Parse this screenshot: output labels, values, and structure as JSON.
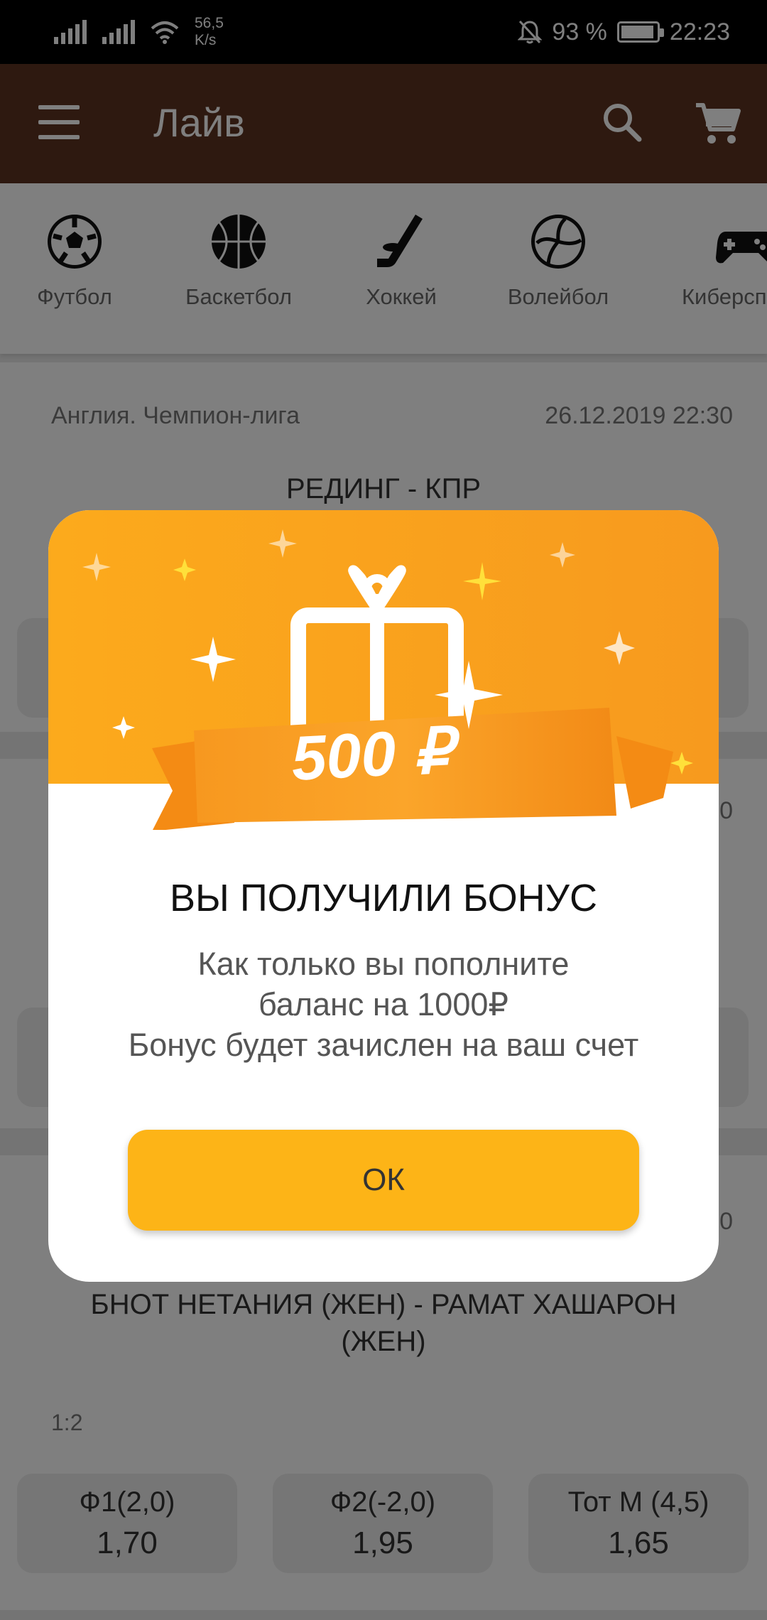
{
  "status_bar": {
    "net_speed_value": "56,5",
    "net_speed_unit": "K/s",
    "battery_percent": "93 %",
    "battery_level": 0.93,
    "time": "22:23"
  },
  "app_bar": {
    "title": "Лайв",
    "color": "#5c3220"
  },
  "sports": [
    {
      "label": "Футбол",
      "icon": "soccer-ball-icon"
    },
    {
      "label": "Баскетбол",
      "icon": "basketball-icon"
    },
    {
      "label": "Хоккей",
      "icon": "hockey-stick-icon"
    },
    {
      "label": "Волейбол",
      "icon": "volleyball-icon"
    },
    {
      "label": "Киберсп",
      "icon": "gamepad-icon"
    }
  ],
  "matches": [
    {
      "league": "Англия. Чемпион-лига",
      "date": "26.12.2019 22:30",
      "teams": "РЕДИНГ - КПР"
    },
    {
      "date_partial": "0"
    },
    {
      "date_partial": "0",
      "teams_line1": "БНОТ НЕТАНИЯ (ЖЕН) - РАМАТ ХАШАРОН",
      "teams_line2": "(ЖЕН)",
      "score": "1:2",
      "odds": [
        {
          "name": "Ф1(2,0)",
          "value": "1,70"
        },
        {
          "name": "Ф2(-2,0)",
          "value": "1,95"
        },
        {
          "name": "Тот М (4,5)",
          "value": "1,65"
        }
      ]
    }
  ],
  "dialog": {
    "banner_amount": "500 ₽",
    "title": "ВЫ ПОЛУЧИЛИ БОНУС",
    "text_line1": "Как только вы пополните",
    "text_line2": "баланс на 1000₽",
    "text_line3": "Бонус будет зачислен на ваш счет",
    "ok_label": "ОК",
    "accent_color": "#fdb417"
  }
}
